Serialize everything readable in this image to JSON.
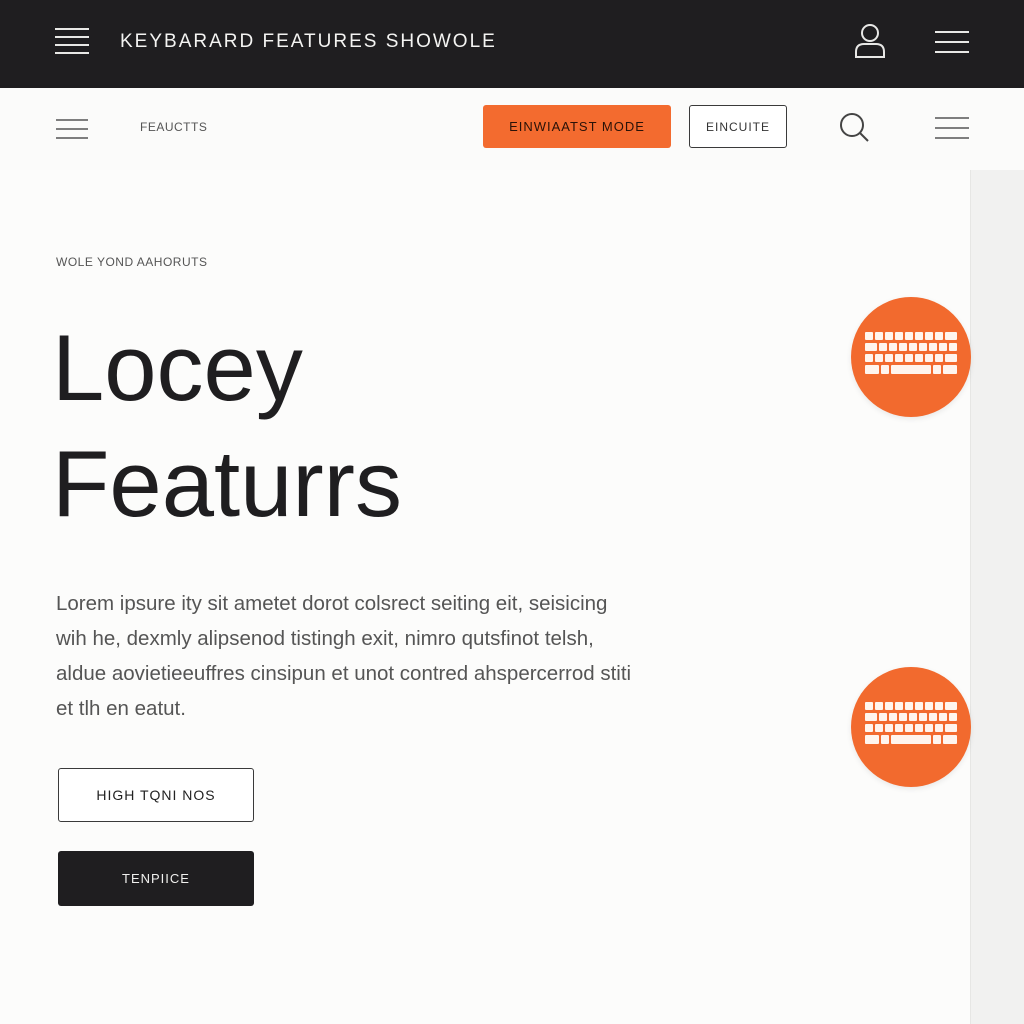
{
  "header": {
    "title": "KEYBARARD FEATURES SHOWOLE",
    "menu_icon": "hamburger-icon",
    "user_icon": "user-icon",
    "more_icon": "hamburger-icon"
  },
  "toolbar": {
    "menu_icon": "hamburger-icon",
    "breadcrumb": "FEAUCTTS",
    "primary_button": "EINWIAATST MODE",
    "secondary_button": "EINCUITE",
    "search_icon": "search-icon",
    "more_icon": "hamburger-icon"
  },
  "main": {
    "eyebrow": "WOLE YOND AAHORUTS",
    "headline_line1": "Locey",
    "headline_line2": "Featurrs",
    "body": "Lorem ipsure ity sit ametet dorot colsrect seiting eit, seisicing wih he, dexmly alipsenod tistingh exit, nimro qutsfinot telsh, aldue aovietieeuffres cinsipun et unot contred ahspercerrod stiti et tlh en eatut.",
    "outline_button": "HIGH TQNI NOS",
    "dark_button": "TENPIICE"
  },
  "badges": [
    {
      "icon": "keyboard-icon"
    },
    {
      "icon": "keyboard-icon"
    }
  ],
  "colors": {
    "accent": "#f36b2f",
    "dark": "#1f1e20",
    "background": "#fcfcfb"
  }
}
